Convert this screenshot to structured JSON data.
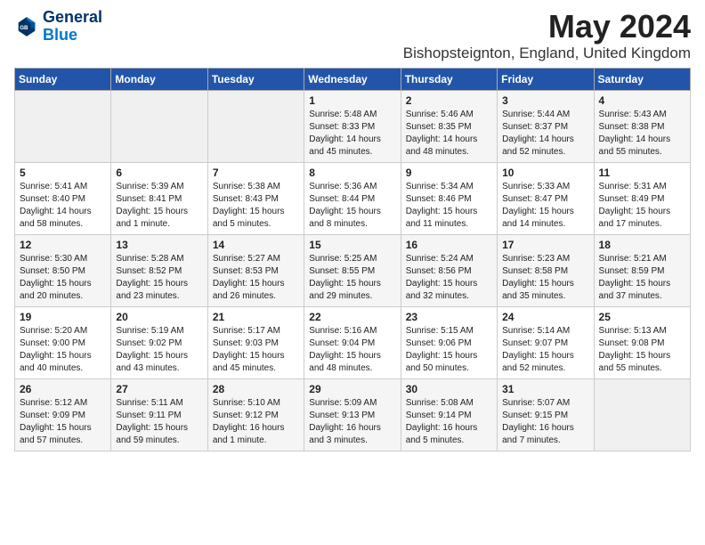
{
  "logo": {
    "line1": "General",
    "line2": "Blue"
  },
  "title": {
    "month_year": "May 2024",
    "location": "Bishopsteignton, England, United Kingdom"
  },
  "days_header": [
    "Sunday",
    "Monday",
    "Tuesday",
    "Wednesday",
    "Thursday",
    "Friday",
    "Saturday"
  ],
  "weeks": [
    [
      {
        "day": "",
        "sunrise": "",
        "sunset": "",
        "daylight": ""
      },
      {
        "day": "",
        "sunrise": "",
        "sunset": "",
        "daylight": ""
      },
      {
        "day": "",
        "sunrise": "",
        "sunset": "",
        "daylight": ""
      },
      {
        "day": "1",
        "sunrise": "Sunrise: 5:48 AM",
        "sunset": "Sunset: 8:33 PM",
        "daylight": "Daylight: 14 hours and 45 minutes."
      },
      {
        "day": "2",
        "sunrise": "Sunrise: 5:46 AM",
        "sunset": "Sunset: 8:35 PM",
        "daylight": "Daylight: 14 hours and 48 minutes."
      },
      {
        "day": "3",
        "sunrise": "Sunrise: 5:44 AM",
        "sunset": "Sunset: 8:37 PM",
        "daylight": "Daylight: 14 hours and 52 minutes."
      },
      {
        "day": "4",
        "sunrise": "Sunrise: 5:43 AM",
        "sunset": "Sunset: 8:38 PM",
        "daylight": "Daylight: 14 hours and 55 minutes."
      }
    ],
    [
      {
        "day": "5",
        "sunrise": "Sunrise: 5:41 AM",
        "sunset": "Sunset: 8:40 PM",
        "daylight": "Daylight: 14 hours and 58 minutes."
      },
      {
        "day": "6",
        "sunrise": "Sunrise: 5:39 AM",
        "sunset": "Sunset: 8:41 PM",
        "daylight": "Daylight: 15 hours and 1 minute."
      },
      {
        "day": "7",
        "sunrise": "Sunrise: 5:38 AM",
        "sunset": "Sunset: 8:43 PM",
        "daylight": "Daylight: 15 hours and 5 minutes."
      },
      {
        "day": "8",
        "sunrise": "Sunrise: 5:36 AM",
        "sunset": "Sunset: 8:44 PM",
        "daylight": "Daylight: 15 hours and 8 minutes."
      },
      {
        "day": "9",
        "sunrise": "Sunrise: 5:34 AM",
        "sunset": "Sunset: 8:46 PM",
        "daylight": "Daylight: 15 hours and 11 minutes."
      },
      {
        "day": "10",
        "sunrise": "Sunrise: 5:33 AM",
        "sunset": "Sunset: 8:47 PM",
        "daylight": "Daylight: 15 hours and 14 minutes."
      },
      {
        "day": "11",
        "sunrise": "Sunrise: 5:31 AM",
        "sunset": "Sunset: 8:49 PM",
        "daylight": "Daylight: 15 hours and 17 minutes."
      }
    ],
    [
      {
        "day": "12",
        "sunrise": "Sunrise: 5:30 AM",
        "sunset": "Sunset: 8:50 PM",
        "daylight": "Daylight: 15 hours and 20 minutes."
      },
      {
        "day": "13",
        "sunrise": "Sunrise: 5:28 AM",
        "sunset": "Sunset: 8:52 PM",
        "daylight": "Daylight: 15 hours and 23 minutes."
      },
      {
        "day": "14",
        "sunrise": "Sunrise: 5:27 AM",
        "sunset": "Sunset: 8:53 PM",
        "daylight": "Daylight: 15 hours and 26 minutes."
      },
      {
        "day": "15",
        "sunrise": "Sunrise: 5:25 AM",
        "sunset": "Sunset: 8:55 PM",
        "daylight": "Daylight: 15 hours and 29 minutes."
      },
      {
        "day": "16",
        "sunrise": "Sunrise: 5:24 AM",
        "sunset": "Sunset: 8:56 PM",
        "daylight": "Daylight: 15 hours and 32 minutes."
      },
      {
        "day": "17",
        "sunrise": "Sunrise: 5:23 AM",
        "sunset": "Sunset: 8:58 PM",
        "daylight": "Daylight: 15 hours and 35 minutes."
      },
      {
        "day": "18",
        "sunrise": "Sunrise: 5:21 AM",
        "sunset": "Sunset: 8:59 PM",
        "daylight": "Daylight: 15 hours and 37 minutes."
      }
    ],
    [
      {
        "day": "19",
        "sunrise": "Sunrise: 5:20 AM",
        "sunset": "Sunset: 9:00 PM",
        "daylight": "Daylight: 15 hours and 40 minutes."
      },
      {
        "day": "20",
        "sunrise": "Sunrise: 5:19 AM",
        "sunset": "Sunset: 9:02 PM",
        "daylight": "Daylight: 15 hours and 43 minutes."
      },
      {
        "day": "21",
        "sunrise": "Sunrise: 5:17 AM",
        "sunset": "Sunset: 9:03 PM",
        "daylight": "Daylight: 15 hours and 45 minutes."
      },
      {
        "day": "22",
        "sunrise": "Sunrise: 5:16 AM",
        "sunset": "Sunset: 9:04 PM",
        "daylight": "Daylight: 15 hours and 48 minutes."
      },
      {
        "day": "23",
        "sunrise": "Sunrise: 5:15 AM",
        "sunset": "Sunset: 9:06 PM",
        "daylight": "Daylight: 15 hours and 50 minutes."
      },
      {
        "day": "24",
        "sunrise": "Sunrise: 5:14 AM",
        "sunset": "Sunset: 9:07 PM",
        "daylight": "Daylight: 15 hours and 52 minutes."
      },
      {
        "day": "25",
        "sunrise": "Sunrise: 5:13 AM",
        "sunset": "Sunset: 9:08 PM",
        "daylight": "Daylight: 15 hours and 55 minutes."
      }
    ],
    [
      {
        "day": "26",
        "sunrise": "Sunrise: 5:12 AM",
        "sunset": "Sunset: 9:09 PM",
        "daylight": "Daylight: 15 hours and 57 minutes."
      },
      {
        "day": "27",
        "sunrise": "Sunrise: 5:11 AM",
        "sunset": "Sunset: 9:11 PM",
        "daylight": "Daylight: 15 hours and 59 minutes."
      },
      {
        "day": "28",
        "sunrise": "Sunrise: 5:10 AM",
        "sunset": "Sunset: 9:12 PM",
        "daylight": "Daylight: 16 hours and 1 minute."
      },
      {
        "day": "29",
        "sunrise": "Sunrise: 5:09 AM",
        "sunset": "Sunset: 9:13 PM",
        "daylight": "Daylight: 16 hours and 3 minutes."
      },
      {
        "day": "30",
        "sunrise": "Sunrise: 5:08 AM",
        "sunset": "Sunset: 9:14 PM",
        "daylight": "Daylight: 16 hours and 5 minutes."
      },
      {
        "day": "31",
        "sunrise": "Sunrise: 5:07 AM",
        "sunset": "Sunset: 9:15 PM",
        "daylight": "Daylight: 16 hours and 7 minutes."
      },
      {
        "day": "",
        "sunrise": "",
        "sunset": "",
        "daylight": ""
      }
    ]
  ]
}
